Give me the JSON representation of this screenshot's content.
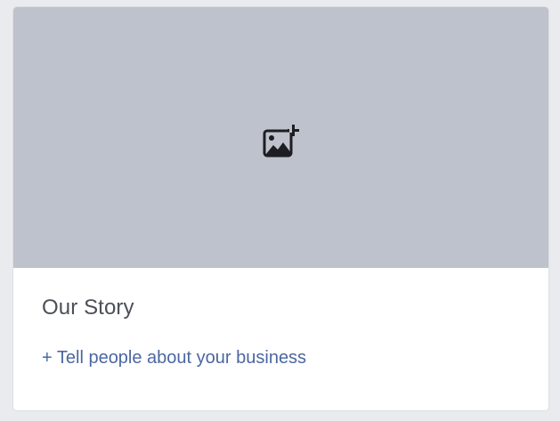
{
  "card": {
    "image_placeholder": {
      "icon": "add-photo-icon",
      "background": "#bec2cc"
    },
    "title": "Our Story",
    "cta_label": "+ Tell people about your business",
    "colors": {
      "title": "#4b4f56",
      "link": "#4b67a1",
      "page_background": "#e9ebee"
    }
  }
}
